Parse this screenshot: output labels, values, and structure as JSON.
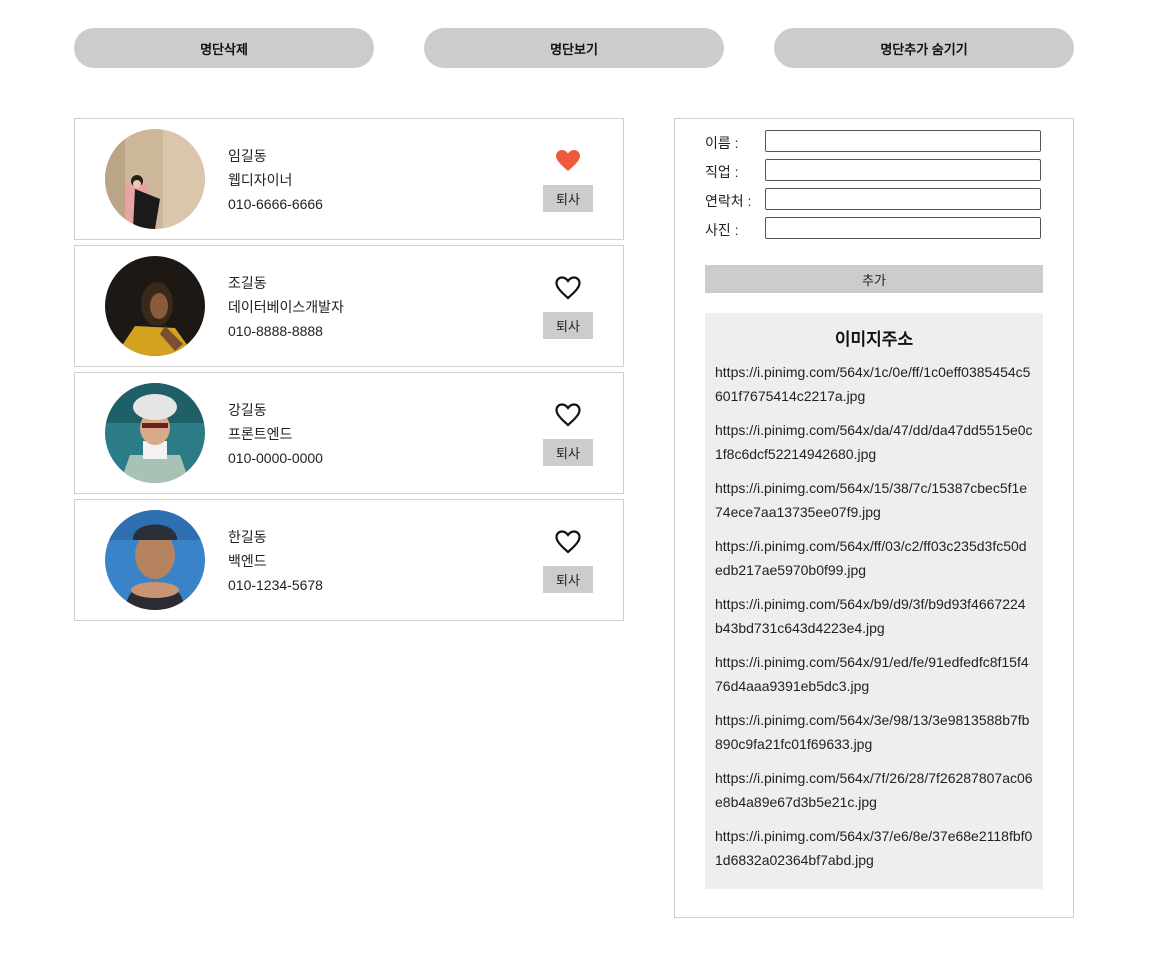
{
  "top_buttons": {
    "delete_list": "명단삭제",
    "view_list": "명단보기",
    "toggle_add": "명단추가 숨기기"
  },
  "people": [
    {
      "name": "임길동",
      "job": "웹디자이너",
      "phone": "010-6666-6666",
      "liked": true,
      "quit_label": "퇴사"
    },
    {
      "name": "조길동",
      "job": "데이터베이스개발자",
      "phone": "010-8888-8888",
      "liked": false,
      "quit_label": "퇴사"
    },
    {
      "name": "강길동",
      "job": "프론트엔드",
      "phone": "010-0000-0000",
      "liked": false,
      "quit_label": "퇴사"
    },
    {
      "name": "한길동",
      "job": "백엔드",
      "phone": "010-1234-5678",
      "liked": false,
      "quit_label": "퇴사"
    }
  ],
  "form": {
    "name_label": "이름 :",
    "job_label": "직업 :",
    "phone_label": "연락처 :",
    "photo_label": "사진 :",
    "name_value": "",
    "job_value": "",
    "phone_value": "",
    "photo_value": "",
    "add_label": "추가"
  },
  "image_urls": {
    "title": "이미지주소",
    "urls": [
      "https://i.pinimg.com/564x/1c/0e/ff/1c0eff0385454c5601f7675414c2217a.jpg",
      "https://i.pinimg.com/564x/da/47/dd/da47dd5515e0c1f8c6dcf52214942680.jpg",
      "https://i.pinimg.com/564x/15/38/7c/15387cbec5f1e74ece7aa13735ee07f9.jpg",
      "https://i.pinimg.com/564x/ff/03/c2/ff03c235d3fc50dedb217ae5970b0f99.jpg",
      "https://i.pinimg.com/564x/b9/d9/3f/b9d93f4667224b43bd731c643d4223e4.jpg",
      "https://i.pinimg.com/564x/91/ed/fe/91edfedfc8f15f476d4aaa9391eb5dc3.jpg",
      "https://i.pinimg.com/564x/3e/98/13/3e9813588b7fb890c9fa21fc01f69633.jpg",
      "https://i.pinimg.com/564x/7f/26/28/7f26287807ac06e8b4a89e67d3b5e21c.jpg",
      "https://i.pinimg.com/564x/37/e6/8e/37e68e2118fbf01d6832a02364bf7abd.jpg"
    ]
  },
  "colors": {
    "button_gray": "#cccccc",
    "heart_filled": "#f05a3c",
    "url_box_bg": "#eeeeee",
    "border": "#cfcfcf"
  }
}
